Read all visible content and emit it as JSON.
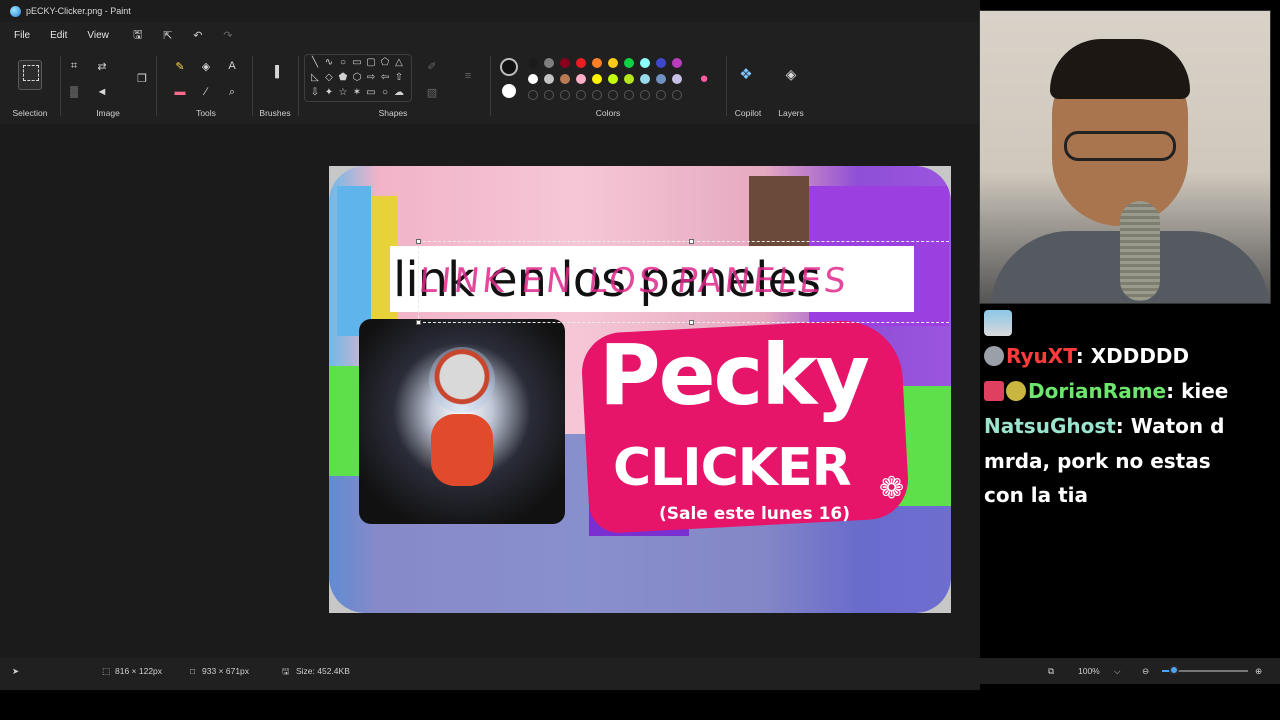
{
  "window": {
    "title": "pECKY-Clicker.png - Paint"
  },
  "menu": {
    "file": "File",
    "edit": "Edit",
    "view": "View"
  },
  "ribbon": {
    "selection": "Selection",
    "image": "Image",
    "tools": "Tools",
    "brushes": "Brushes",
    "shapes": "Shapes",
    "colors": "Colors",
    "copilot": "Copilot",
    "layers": "Layers"
  },
  "palette": {
    "row1": [
      "#1b1b1b",
      "#7f7f7f",
      "#88001b",
      "#ec1c24",
      "#ff7f27",
      "#ffca18",
      "#0ed145",
      "#8cfffb",
      "#3f48cc",
      "#b83dba"
    ],
    "row2": [
      "#ffffff",
      "#c3c3c3",
      "#b97a56",
      "#ffaec8",
      "#fff200",
      "#c4ff0e",
      "#b5e61d",
      "#99d9ea",
      "#7092be",
      "#c8bfe7"
    ],
    "primary": "#111111",
    "secondary": "#ffffff"
  },
  "artwork": {
    "banner_text": "link en los paneles",
    "scribble_text": "LINK EN LOS PANELES",
    "title": "Pecky",
    "subtitle": "CLICKER",
    "release": "(Sale este lunes 16)",
    "accent": "#e6156a"
  },
  "status": {
    "selection_size": "816 × 122px",
    "canvas_size": "933 × 671px",
    "file_size": "Size: 452.4KB",
    "zoom": "100%",
    "zoom_fraction": 0.1
  },
  "chat": {
    "messages": [
      {
        "user": "RyuXT",
        "user_color": "#ff3b3b",
        "text": ": XDDDDD"
      },
      {
        "user": "DorianRame",
        "user_color": "#6ee66e",
        "text": ": kiee"
      },
      {
        "user": "NatsuGhost",
        "user_color": "#9be5cf",
        "text": ":  Waton d"
      },
      {
        "user": "",
        "user_color": "#ffffff",
        "text": "mrda, pork no estas"
      },
      {
        "user": "",
        "user_color": "#ffffff",
        "text": "con la tia"
      }
    ]
  }
}
